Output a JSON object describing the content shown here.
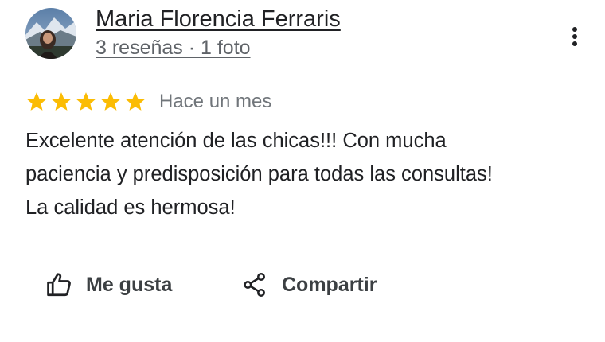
{
  "review": {
    "author": {
      "name": "Maria Florencia Ferraris",
      "meta": "3 reseñas · 1 foto",
      "avatar_icon": "profile-photo"
    },
    "more_icon": "more-vertical-icon",
    "rating": {
      "stars": 5,
      "max": 5,
      "star_color": "#fbbc04"
    },
    "date": "Hace un mes",
    "text_lines": [
      "Excelente atención de las chicas!!! Con mucha",
      "paciencia y predisposición para todas las consultas!",
      "La calidad es hermosa!"
    ],
    "actions": {
      "like_label": "Me gusta",
      "like_icon": "thumbs-up-icon",
      "share_label": "Compartir",
      "share_icon": "share-icon"
    }
  }
}
